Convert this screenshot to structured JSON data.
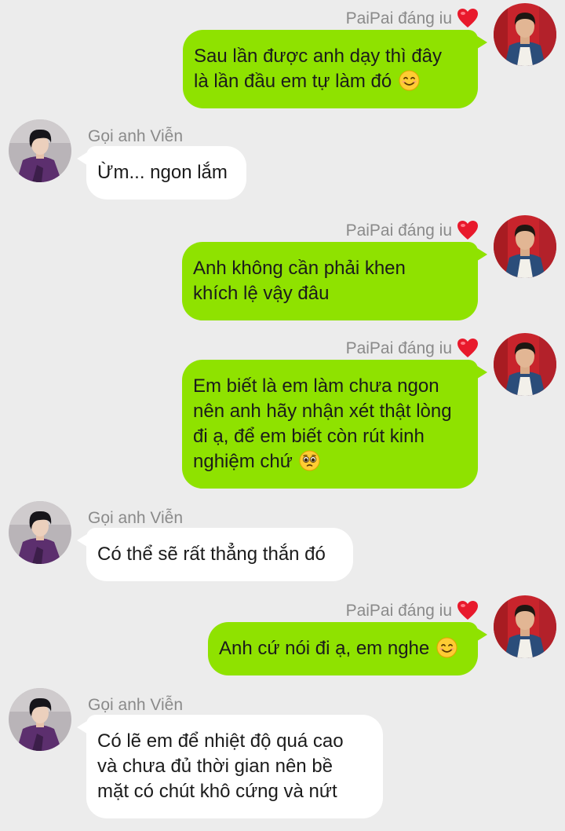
{
  "conversation": {
    "me": {
      "name": "PaiPai đáng iu",
      "badge_icon": "heart-icon",
      "bubble_color": "#8fe200"
    },
    "other": {
      "name": "Gọi anh Viễn",
      "bubble_color": "#ffffff"
    },
    "messages": [
      {
        "sender": "me",
        "lines": [
          "Sau lần được anh dạy thì đây",
          "là lần đầu em tự làm đó"
        ],
        "emoji": "smiling-face-icon"
      },
      {
        "sender": "other",
        "lines": [
          "Ừm... ngon lắm"
        ]
      },
      {
        "sender": "me",
        "lines": [
          "Anh không cần phải khen",
          "khích lệ vậy đâu"
        ]
      },
      {
        "sender": "me",
        "lines": [
          "Em biết là em làm chưa ngon",
          "nên anh hãy nhận xét thật lòng",
          "đi ạ, để em biết còn rút kinh",
          "nghiệm chứ"
        ],
        "emoji": "pleading-face-icon"
      },
      {
        "sender": "other",
        "lines": [
          "Có thể sẽ rất thẳng thắn đó"
        ]
      },
      {
        "sender": "me",
        "lines": [
          "Anh cứ nói đi ạ, em nghe"
        ],
        "emoji": "smiling-face-icon"
      },
      {
        "sender": "other",
        "lines": [
          "Có lẽ em để nhiệt độ quá cao",
          "và chưa đủ thời gian nên bề",
          "mặt có chút khô cứng và nứt"
        ]
      }
    ]
  }
}
